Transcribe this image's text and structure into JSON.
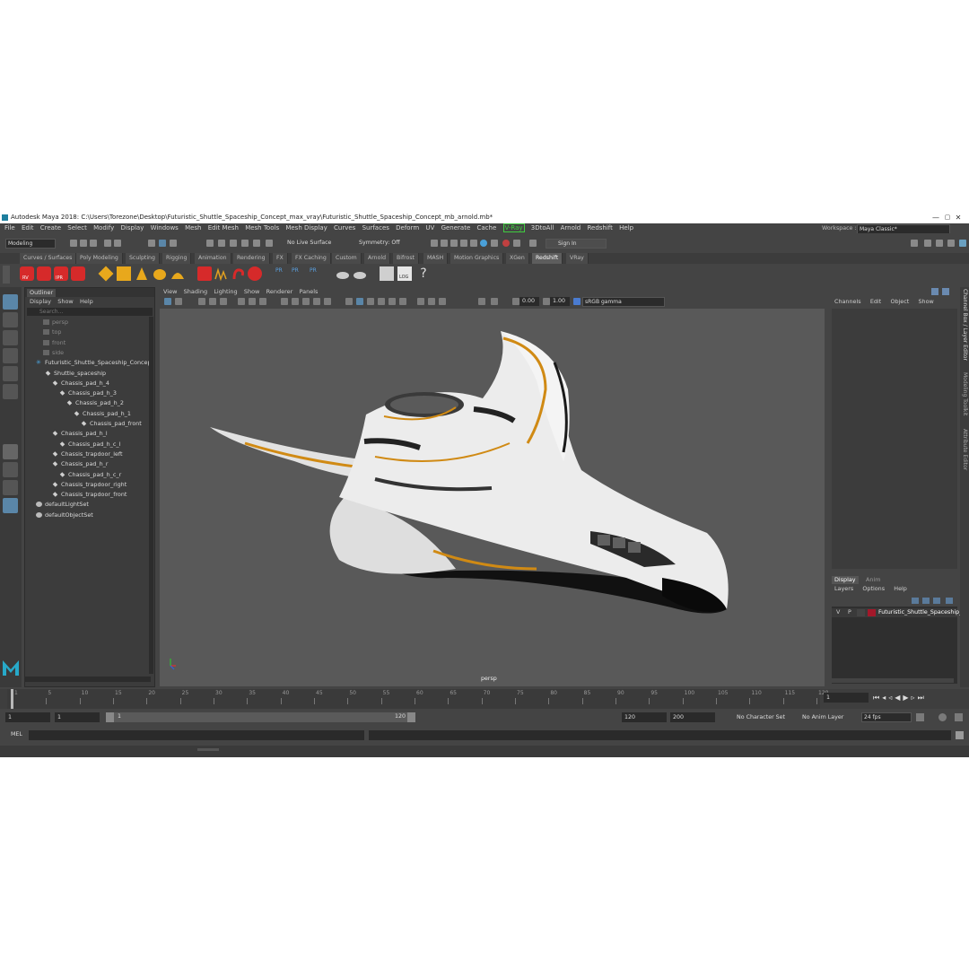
{
  "window": {
    "title": "Autodesk Maya 2018: C:\\Users\\Torezone\\Desktop\\Futuristic_Shuttle_Spaceship_Concept_max_vray\\Futuristic_Shuttle_Spaceship_Concept_mb_arnold.mb*",
    "controls": [
      "—",
      "▢",
      "✕"
    ]
  },
  "menubar": {
    "items": [
      "File",
      "Edit",
      "Create",
      "Select",
      "Modify",
      "Display",
      "Windows",
      "Mesh",
      "Edit Mesh",
      "Mesh Tools",
      "Mesh Display",
      "Curves",
      "Surfaces",
      "Deform",
      "UV",
      "Generate",
      "Cache"
    ],
    "vray": "V-Ray",
    "items2": [
      "3DtoAll",
      "Arnold",
      "Redshift",
      "Help"
    ],
    "workspace_label": "Workspace :",
    "workspace_value": "Maya Classic*"
  },
  "toolbar": {
    "mode": "Modeling",
    "live_surface": "No Live Surface",
    "symmetry": "Symmetry: Off",
    "sign_in": "Sign In"
  },
  "shelf_tabs": [
    "Curves / Surfaces",
    "Poly Modeling",
    "Sculpting",
    "Rigging",
    "Animation",
    "Rendering",
    "FX",
    "FX Caching",
    "Custom",
    "Arnold",
    "Bifrost",
    "MASH",
    "Motion Graphics",
    "XGen",
    "Redshift",
    "VRay"
  ],
  "shelf_active": "Redshift",
  "shelf_icon_labels": [
    "RV",
    "IPR",
    "PR",
    "PR",
    "PR",
    "LOG"
  ],
  "outliner": {
    "tab": "Outliner",
    "menu": [
      "Display",
      "Show",
      "Help"
    ],
    "search_placeholder": "Search...",
    "items": [
      {
        "label": "persp",
        "dim": true
      },
      {
        "label": "top",
        "dim": true
      },
      {
        "label": "front",
        "dim": true
      },
      {
        "label": "side",
        "dim": true
      },
      {
        "label": "Futuristic_Shuttle_Spaceship_Concep",
        "dim": false
      },
      {
        "label": "Shuttle_spaceship",
        "dim": false
      },
      {
        "label": "Chassis_pad_h_4",
        "dim": false
      },
      {
        "label": "Chassis_pad_h_3",
        "dim": false
      },
      {
        "label": "Chassis_pad_h_2",
        "dim": false
      },
      {
        "label": "Chassis_pad_h_1",
        "dim": false
      },
      {
        "label": "Chassis_pad_front",
        "dim": false
      },
      {
        "label": "Chassis_pad_h_l",
        "dim": false
      },
      {
        "label": "Chassis_pad_h_c_l",
        "dim": false
      },
      {
        "label": "Chassis_trapdoor_left",
        "dim": false
      },
      {
        "label": "Chassis_pad_h_r",
        "dim": false
      },
      {
        "label": "Chassis_pad_h_c_r",
        "dim": false
      },
      {
        "label": "Chassis_trapdoor_right",
        "dim": false
      },
      {
        "label": "Chassis_trapdoor_front",
        "dim": false
      },
      {
        "label": "defaultLightSet",
        "dim": false
      },
      {
        "label": "defaultObjectSet",
        "dim": false
      }
    ]
  },
  "viewport": {
    "menu": [
      "View",
      "Shading",
      "Lighting",
      "Show",
      "Renderer",
      "Panels"
    ],
    "exposure": "0.00",
    "gamma": "1.00",
    "color_space": "sRGB gamma",
    "camera": "persp"
  },
  "channel_box": {
    "menu": [
      "Channels",
      "Edit",
      "Object",
      "Show"
    ]
  },
  "layer_editor": {
    "tabs": [
      "Display",
      "Anim"
    ],
    "menu": [
      "Layers",
      "Options",
      "Help"
    ],
    "layer": {
      "v": "V",
      "p": "P",
      "name": "Futuristic_Shuttle_Spaceship_C",
      "color": "#a3182a"
    }
  },
  "right_strip": [
    "Channel Box / Layer Editor",
    "Modeling Toolkit",
    "Attribute Editor"
  ],
  "timeline": {
    "ticks": [
      "1",
      "5",
      "10",
      "15",
      "20",
      "25",
      "30",
      "35",
      "40",
      "45",
      "50",
      "55",
      "60",
      "65",
      "70",
      "75",
      "80",
      "85",
      "90",
      "95",
      "100",
      "105",
      "110",
      "115",
      "120"
    ],
    "current_frame": "1"
  },
  "range": {
    "start": "1",
    "anim_start": "1",
    "slider_start": "1",
    "slider_end": "120",
    "end": "120",
    "anim_end": "200",
    "character_set": "No Character Set",
    "anim_layer": "No Anim Layer",
    "fps": "24 fps"
  },
  "command": {
    "lang": "MEL"
  }
}
